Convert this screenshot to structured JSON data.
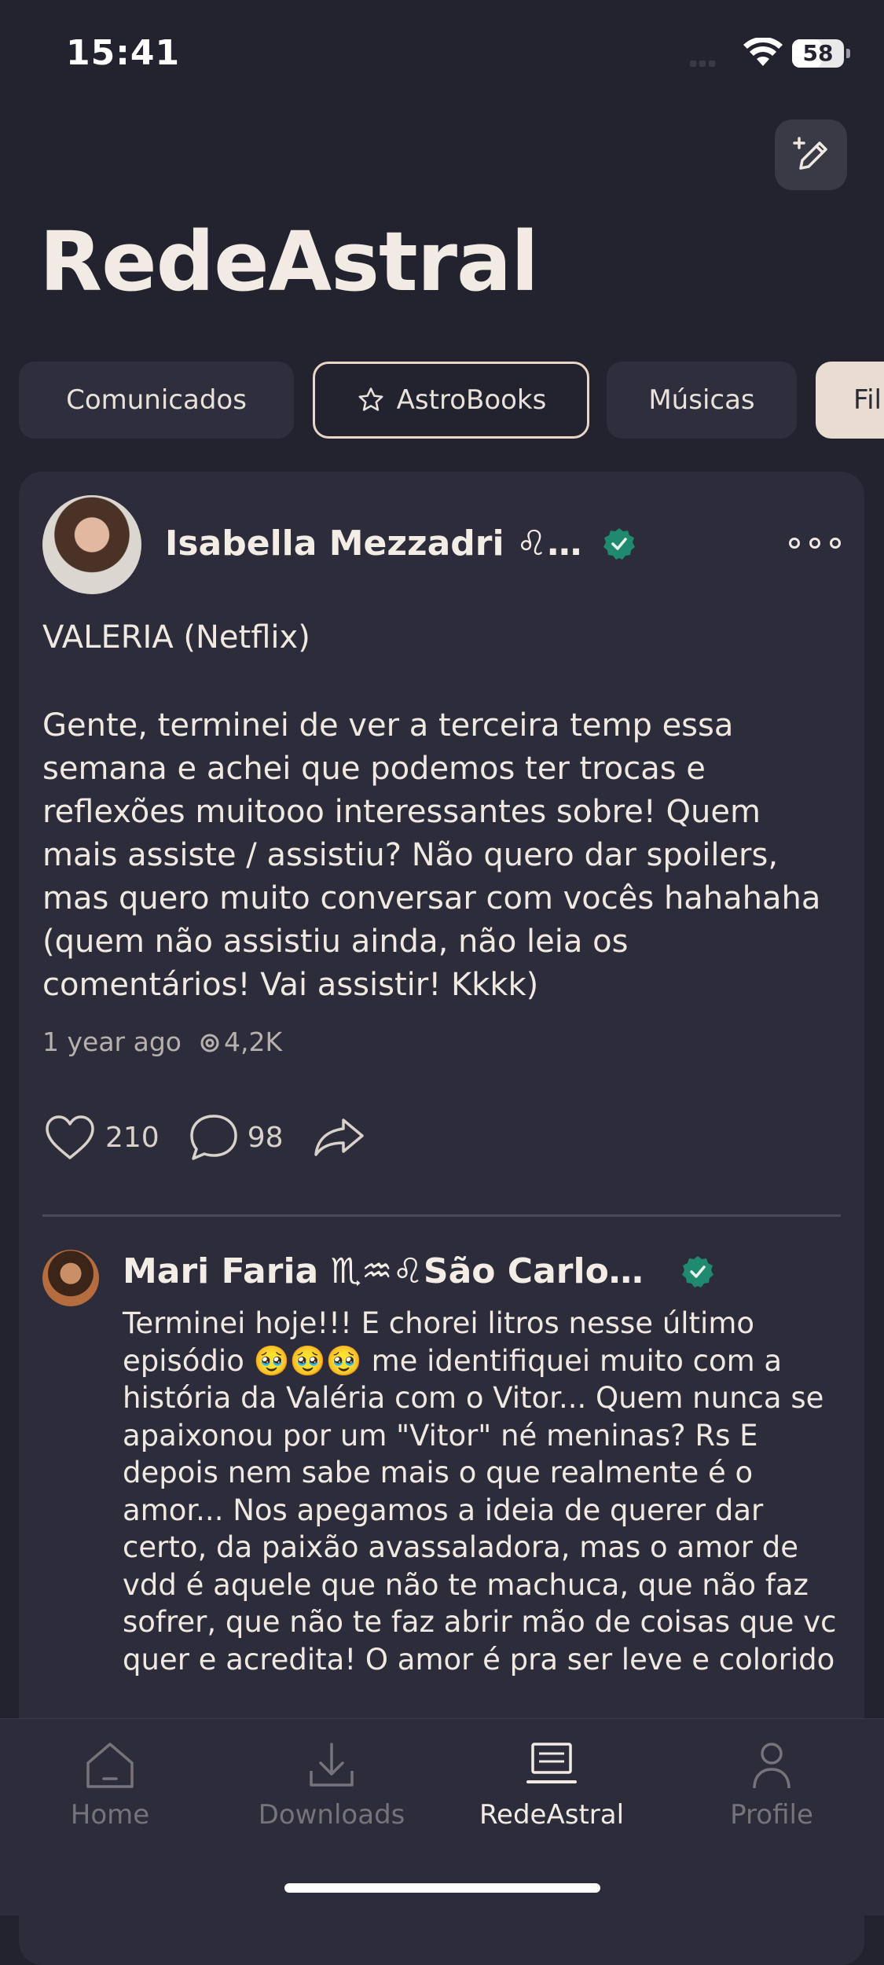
{
  "status": {
    "time": "15:41",
    "battery": "58",
    "battery_level": 0.58
  },
  "header": {
    "title": "RedeAstral",
    "compose_icon": "pencil-plus-icon"
  },
  "chips": [
    {
      "label": "Comunicados"
    },
    {
      "label": "AstroBooks",
      "icon": "star-icon"
    },
    {
      "label": "Músicas"
    },
    {
      "label": "Fil"
    }
  ],
  "post": {
    "author": "Isabella Mezzadri ♌…",
    "title": "VALERIA (Netflix)",
    "body": "Gente, terminei de ver a terceira temp essa semana e achei que podemos ter trocas e reflexões muitooo interessantes sobre! Quem mais assiste / assistiu? Não quero dar spoilers, mas quero muito conversar com vocês hahahaha (quem não assistiu ainda, não leia os comentários! Vai assistir! Kkkk)",
    "time_ago": "1 year ago",
    "views": "4,2K",
    "likes": "210",
    "comments": "98"
  },
  "comment": {
    "author": "Mari Faria ♏♒♌São Carlo…",
    "text": "Terminei hoje!!! E chorei litros nesse último episódio 🥹🥹🥹 me identifiquei muito com a história da Valéria com o Vitor... Quem nunca se apaixonou por um \"Vitor\" né meninas? Rs E depois nem sabe mais o que realmente é o amor... Nos apegamos a ideia de querer dar certo, da paixão avassaladora, mas o amor de vdd é aquele que não te machuca, que não faz sofrer, que não te faz abrir mão de coisas que vc quer e acredita! O amor é pra ser leve e colorido"
  },
  "tabs": [
    {
      "label": "Home",
      "icon": "home-icon"
    },
    {
      "label": "Downloads",
      "icon": "download-icon"
    },
    {
      "label": "RedeAstral",
      "icon": "laptop-icon",
      "active": true
    },
    {
      "label": "Profile",
      "icon": "person-icon"
    }
  ],
  "colors": {
    "background": "#23222f",
    "card": "#2d2c3a",
    "text": "#efe9e1",
    "verified": "#1f8a6e",
    "chip_light": "#e9ddd1"
  }
}
